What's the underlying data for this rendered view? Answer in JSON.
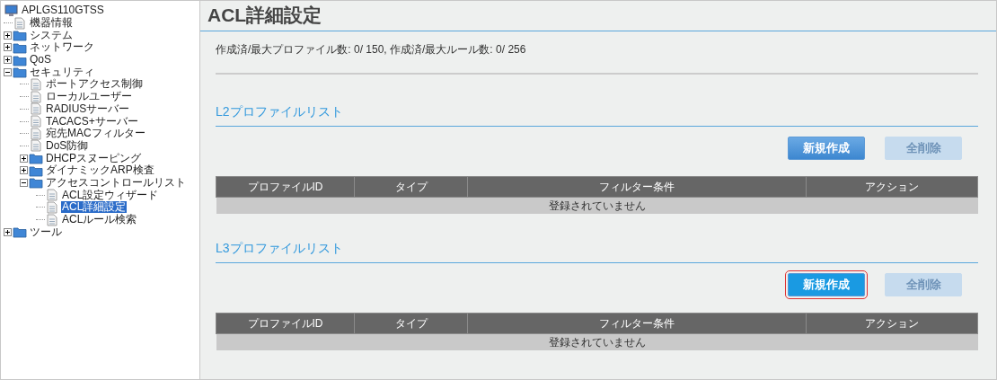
{
  "tree": {
    "label": "APLGS110GTSS",
    "kind": "computer",
    "selected": false,
    "children": [
      {
        "label": "機器情報",
        "kind": "page",
        "selected": false
      },
      {
        "label": "システム",
        "kind": "folder",
        "expanded": false,
        "selected": false
      },
      {
        "label": "ネットワーク",
        "kind": "folder",
        "expanded": false,
        "selected": false
      },
      {
        "label": "QoS",
        "kind": "folder",
        "expanded": false,
        "selected": false
      },
      {
        "label": "セキュリティ",
        "kind": "folder",
        "expanded": true,
        "selected": false,
        "children": [
          {
            "label": "ポートアクセス制御",
            "kind": "page",
            "selected": false
          },
          {
            "label": "ローカルユーザー",
            "kind": "page",
            "selected": false
          },
          {
            "label": "RADIUSサーバー",
            "kind": "page",
            "selected": false
          },
          {
            "label": "TACACS+サーバー",
            "kind": "page",
            "selected": false
          },
          {
            "label": "宛先MACフィルター",
            "kind": "page",
            "selected": false
          },
          {
            "label": "DoS防御",
            "kind": "page",
            "selected": false
          },
          {
            "label": "DHCPスヌーピング",
            "kind": "folder",
            "expanded": false,
            "selected": false
          },
          {
            "label": "ダイナミックARP検査",
            "kind": "folder",
            "expanded": false,
            "selected": false
          },
          {
            "label": "アクセスコントロールリスト",
            "kind": "folder",
            "expanded": true,
            "selected": false,
            "children": [
              {
                "label": "ACL設定ウィザード",
                "kind": "page",
                "selected": false
              },
              {
                "label": "ACL詳細設定",
                "kind": "page",
                "selected": true
              },
              {
                "label": "ACLルール検索",
                "kind": "page",
                "selected": false
              }
            ]
          }
        ]
      },
      {
        "label": "ツール",
        "kind": "folder",
        "expanded": false,
        "selected": false
      }
    ]
  },
  "page_title": "ACL詳細設定",
  "summary": "作成済/最大プロファイル数: 0/ 150, 作成済/最大ルール数: 0/ 256",
  "sections": [
    {
      "title": "L2プロファイルリスト",
      "buttons": [
        {
          "label": "新規作成",
          "disabled": false,
          "highlighted": false
        },
        {
          "label": "全削除",
          "disabled": true,
          "highlighted": false
        }
      ],
      "columns": [
        "プロファイルID",
        "タイプ",
        "フィルター条件",
        "アクション"
      ],
      "empty_message": "登録されていません"
    },
    {
      "title": "L3プロファイルリスト",
      "buttons": [
        {
          "label": "新規作成",
          "disabled": false,
          "highlighted": true
        },
        {
          "label": "全削除",
          "disabled": true,
          "highlighted": false
        }
      ],
      "columns": [
        "プロファイルID",
        "タイプ",
        "フィルター条件",
        "アクション"
      ],
      "empty_message": "登録されていません"
    }
  ]
}
